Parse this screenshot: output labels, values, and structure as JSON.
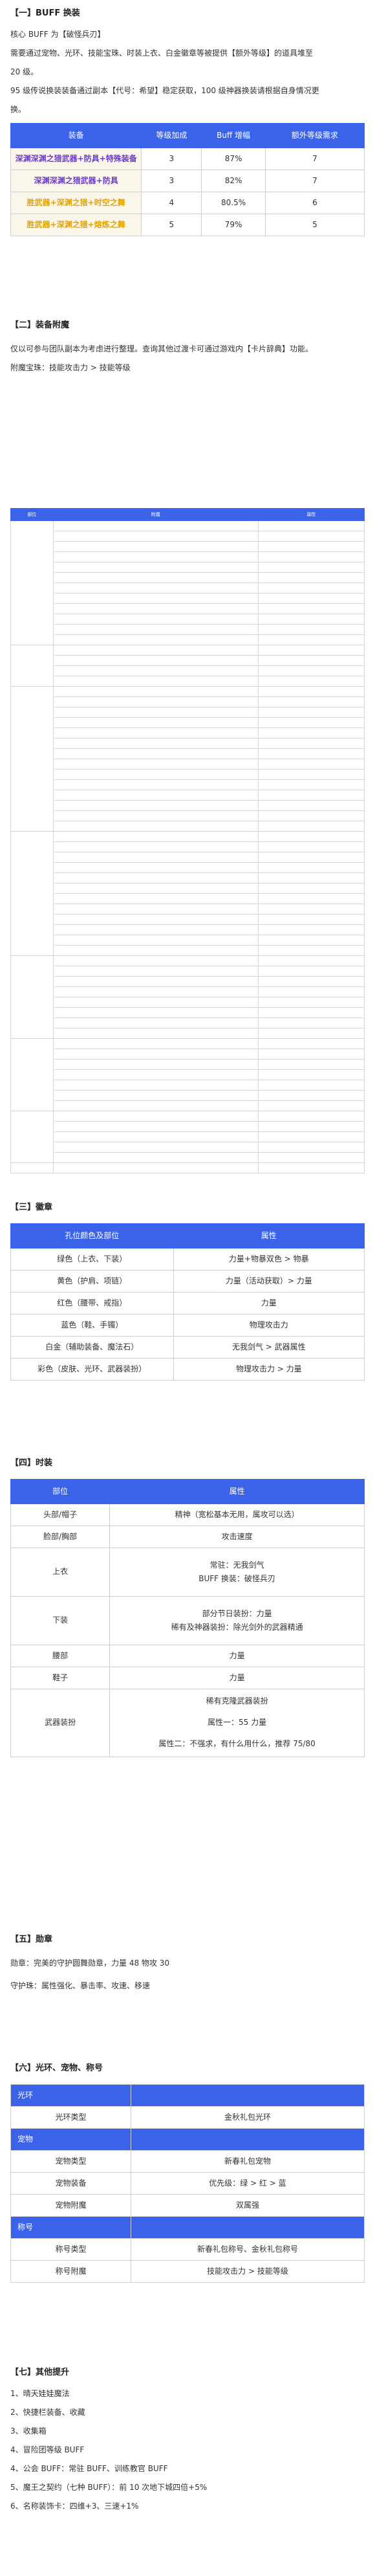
{
  "s1": {
    "title": "【一】BUFF 换装",
    "p1": "核心 BUFF 为【破怪兵刃】",
    "p2": "需要通过宠物、光环、技能宝珠、时装上衣、白金徽章等被提供【额外等级】的道具堆至",
    "p3": "20 级。",
    "p4": "95 级传说换装装备通过副本【代号：希望】稳定获取，100 级神器换装请根据自身情况更",
    "p5": "换。",
    "table": {
      "headers": [
        "装备",
        "等级加成",
        "Buff 增幅",
        "额外等级需求"
      ],
      "rows": [
        [
          "深渊深渊之猎武器+防具+特殊装备",
          "3",
          "87%",
          "7"
        ],
        [
          "深渊深渊之猎武器+防具",
          "3",
          "82%",
          "7"
        ],
        [
          "胜武器+深渊之猎+时空之舞",
          "4",
          "80.5%",
          "6"
        ],
        [
          "胜武器+深渊之猎+熔炼之舞",
          "5",
          "79%",
          "5"
        ]
      ]
    }
  },
  "s2": {
    "title": "【二】装备附魔",
    "p1": "仅以可参与团队副本为考虑进行整理。查询其他过渡卡可通过游戏内【卡片辞典】功能。",
    "p2": "附魔宝珠：技能攻击力 > 技能等级"
  },
  "s3": {
    "title": "【三】徽章",
    "headers": [
      "孔位颜色及部位",
      "属性"
    ],
    "rows": [
      [
        "绿色（上衣、下装）",
        "力量+物暴双色 > 物暴"
      ],
      [
        "黄色（护肩、项链）",
        "力量（活动获取）> 力量"
      ],
      [
        "红色（腰带、戒指）",
        "力量"
      ],
      [
        "蓝色（鞋、手镯）",
        "物理攻击力"
      ],
      [
        "白金（辅助装备、魔法石）",
        "无我剑气 > 武器属性"
      ],
      [
        "彩色（皮肤、光环、武器装扮）",
        "物理攻击力 > 力量"
      ]
    ]
  },
  "s4": {
    "title": "【四】时装",
    "headers": [
      "部位",
      "属性"
    ],
    "rows": [
      {
        "part": "头部/帽子",
        "attrs": [
          "精神（宽松基本无用，属攻可以选）"
        ]
      },
      {
        "part": "脸部/胸部",
        "attrs": [
          "攻击速度"
        ]
      },
      {
        "part": "上衣",
        "attrs": [
          "常驻：无我剑气",
          "BUFF 换装：破怪兵刃"
        ]
      },
      {
        "part": "下装",
        "attrs": [
          "部分节日装扮：力量",
          "稀有及神器装扮：除光剑外的武器精通"
        ]
      },
      {
        "part": "腰部",
        "attrs": [
          "力量"
        ]
      },
      {
        "part": "鞋子",
        "attrs": [
          "力量"
        ]
      },
      {
        "part": "武器装扮",
        "attrs": [
          "稀有克隆武器装扮",
          "属性一：55 力量",
          "属性二：不强求，有什么用什么，推荐 75/80"
        ]
      }
    ]
  },
  "s5": {
    "title": "【五】勋章",
    "p1": "勋章：完美的守护圆舞勋章，力量 48 物攻 30",
    "p2": "守护珠：属性强化、暴击率、攻速、移速"
  },
  "s6": {
    "title": "【六】光环、宠物、称号",
    "groups": [
      {
        "band": "光环",
        "rows": [
          [
            "光环类型",
            "金秋礼包光环"
          ]
        ]
      },
      {
        "band": "宠物",
        "rows": [
          [
            "宠物类型",
            "新春礼包宠物"
          ],
          [
            "宠物装备",
            "优先级：绿 > 红 > 蓝"
          ],
          [
            "宠物附魔",
            "双属强"
          ]
        ]
      },
      {
        "band": "称号",
        "rows": [
          [
            "称号类型",
            "新春礼包称号、金秋礼包称号"
          ],
          [
            "称号附魔",
            "技能攻击力 > 技能等级"
          ]
        ]
      }
    ]
  },
  "s7": {
    "title": "【七】其他提升",
    "items": [
      "1、晴天娃娃魔法",
      "2、快捷栏装备、收藏",
      "3、收集箱",
      "4、冒险团等级 BUFF",
      "4、公会 BUFF：常驻 BUFF、训练教官 BUFF",
      "5、魔王之契约（七种 BUFF）：前 10 次地下城四倍+5%",
      "6、名称装饰卡：四维+3、三速+1%"
    ]
  },
  "bigtable": {
    "head_cols": [
      "部位",
      "附魔",
      "属性"
    ],
    "groups": [
      {
        "name": "",
        "rows": [
          [
            "",
            ""
          ],
          [
            "",
            ""
          ],
          [
            "",
            ""
          ],
          [
            "",
            ""
          ],
          [
            "",
            ""
          ],
          [
            "",
            ""
          ],
          [
            "",
            ""
          ],
          [
            "",
            ""
          ],
          [
            "",
            ""
          ],
          [
            "",
            ""
          ],
          [
            "",
            ""
          ],
          [
            "",
            ""
          ]
        ]
      },
      {
        "name": "",
        "rows": [
          [
            "",
            ""
          ],
          [
            "",
            ""
          ],
          [
            "",
            ""
          ],
          [
            "",
            ""
          ]
        ]
      },
      {
        "name": "",
        "rows": [
          [
            "",
            ""
          ],
          [
            "",
            ""
          ],
          [
            "",
            ""
          ],
          [
            "",
            ""
          ],
          [
            "",
            ""
          ],
          [
            "",
            ""
          ],
          [
            "",
            ""
          ],
          [
            "",
            ""
          ],
          [
            "",
            ""
          ],
          [
            "",
            ""
          ],
          [
            "",
            ""
          ],
          [
            "",
            ""
          ],
          [
            "",
            ""
          ],
          [
            "",
            ""
          ]
        ]
      },
      {
        "name": "",
        "rows": [
          [
            "",
            ""
          ],
          [
            "",
            ""
          ],
          [
            "",
            ""
          ],
          [
            "",
            ""
          ],
          [
            "",
            ""
          ],
          [
            "",
            ""
          ],
          [
            "",
            ""
          ],
          [
            "",
            ""
          ],
          [
            "",
            ""
          ],
          [
            "",
            ""
          ],
          [
            "",
            ""
          ],
          [
            "",
            ""
          ]
        ]
      },
      {
        "name": "",
        "rows": [
          [
            "",
            ""
          ],
          [
            "",
            ""
          ],
          [
            "",
            ""
          ],
          [
            "",
            ""
          ],
          [
            "",
            ""
          ],
          [
            "",
            ""
          ],
          [
            "",
            ""
          ],
          [
            "",
            ""
          ]
        ]
      },
      {
        "name": "",
        "rows": [
          [
            "",
            ""
          ],
          [
            "",
            ""
          ],
          [
            "",
            ""
          ],
          [
            "",
            ""
          ],
          [
            "",
            ""
          ],
          [
            "",
            ""
          ],
          [
            "",
            ""
          ]
        ]
      },
      {
        "name": "",
        "rows": [
          [
            "",
            ""
          ],
          [
            "",
            ""
          ],
          [
            "",
            ""
          ],
          [
            "",
            ""
          ],
          [
            "",
            ""
          ]
        ]
      },
      {
        "name": "",
        "rows": [
          [
            "",
            ""
          ]
        ]
      }
    ]
  }
}
